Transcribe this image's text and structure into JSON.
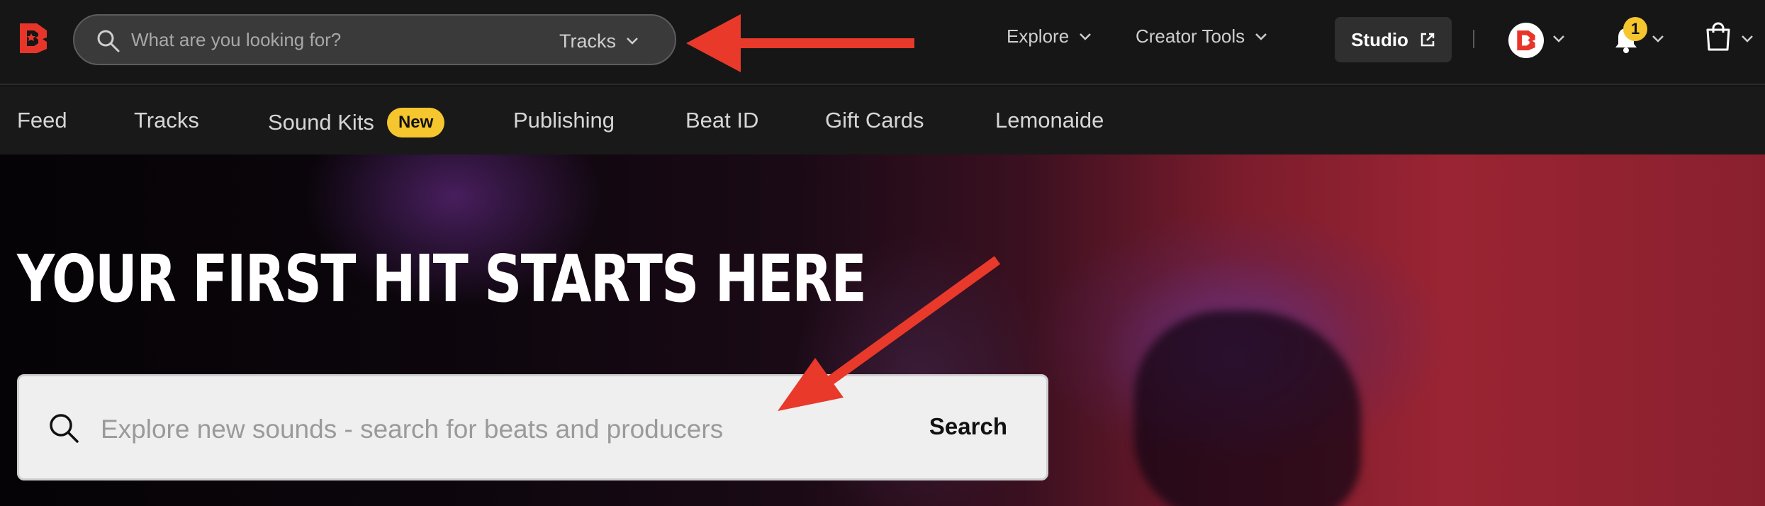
{
  "header": {
    "logo_name": "brand-logo",
    "search": {
      "placeholder": "What are you looking for?",
      "value": "",
      "category": "Tracks"
    },
    "nav": [
      {
        "label": "Explore"
      },
      {
        "label": "Creator Tools"
      }
    ],
    "studio_label": "Studio",
    "divider": "|",
    "notifications_count": "1"
  },
  "subnav": {
    "items": [
      {
        "label": "Feed"
      },
      {
        "label": "Tracks"
      },
      {
        "label": "Sound Kits",
        "badge": "New"
      },
      {
        "label": "Publishing"
      },
      {
        "label": "Beat ID"
      },
      {
        "label": "Gift Cards"
      },
      {
        "label": "Lemonaide"
      }
    ]
  },
  "hero": {
    "title": "YOUR FIRST HIT STARTS HERE",
    "search": {
      "placeholder": "Explore new sounds - search for beats and producers",
      "value": "",
      "button": "Search"
    }
  },
  "colors": {
    "brand_red": "#e8352a",
    "badge_yellow": "#f5c62d",
    "annotation_arrow": "#e8392b"
  },
  "icons": [
    "brand-logo",
    "search-icon",
    "chevron-down-icon",
    "external-link-icon",
    "avatar-logo-icon",
    "bell-icon",
    "shopping-bag-icon"
  ]
}
